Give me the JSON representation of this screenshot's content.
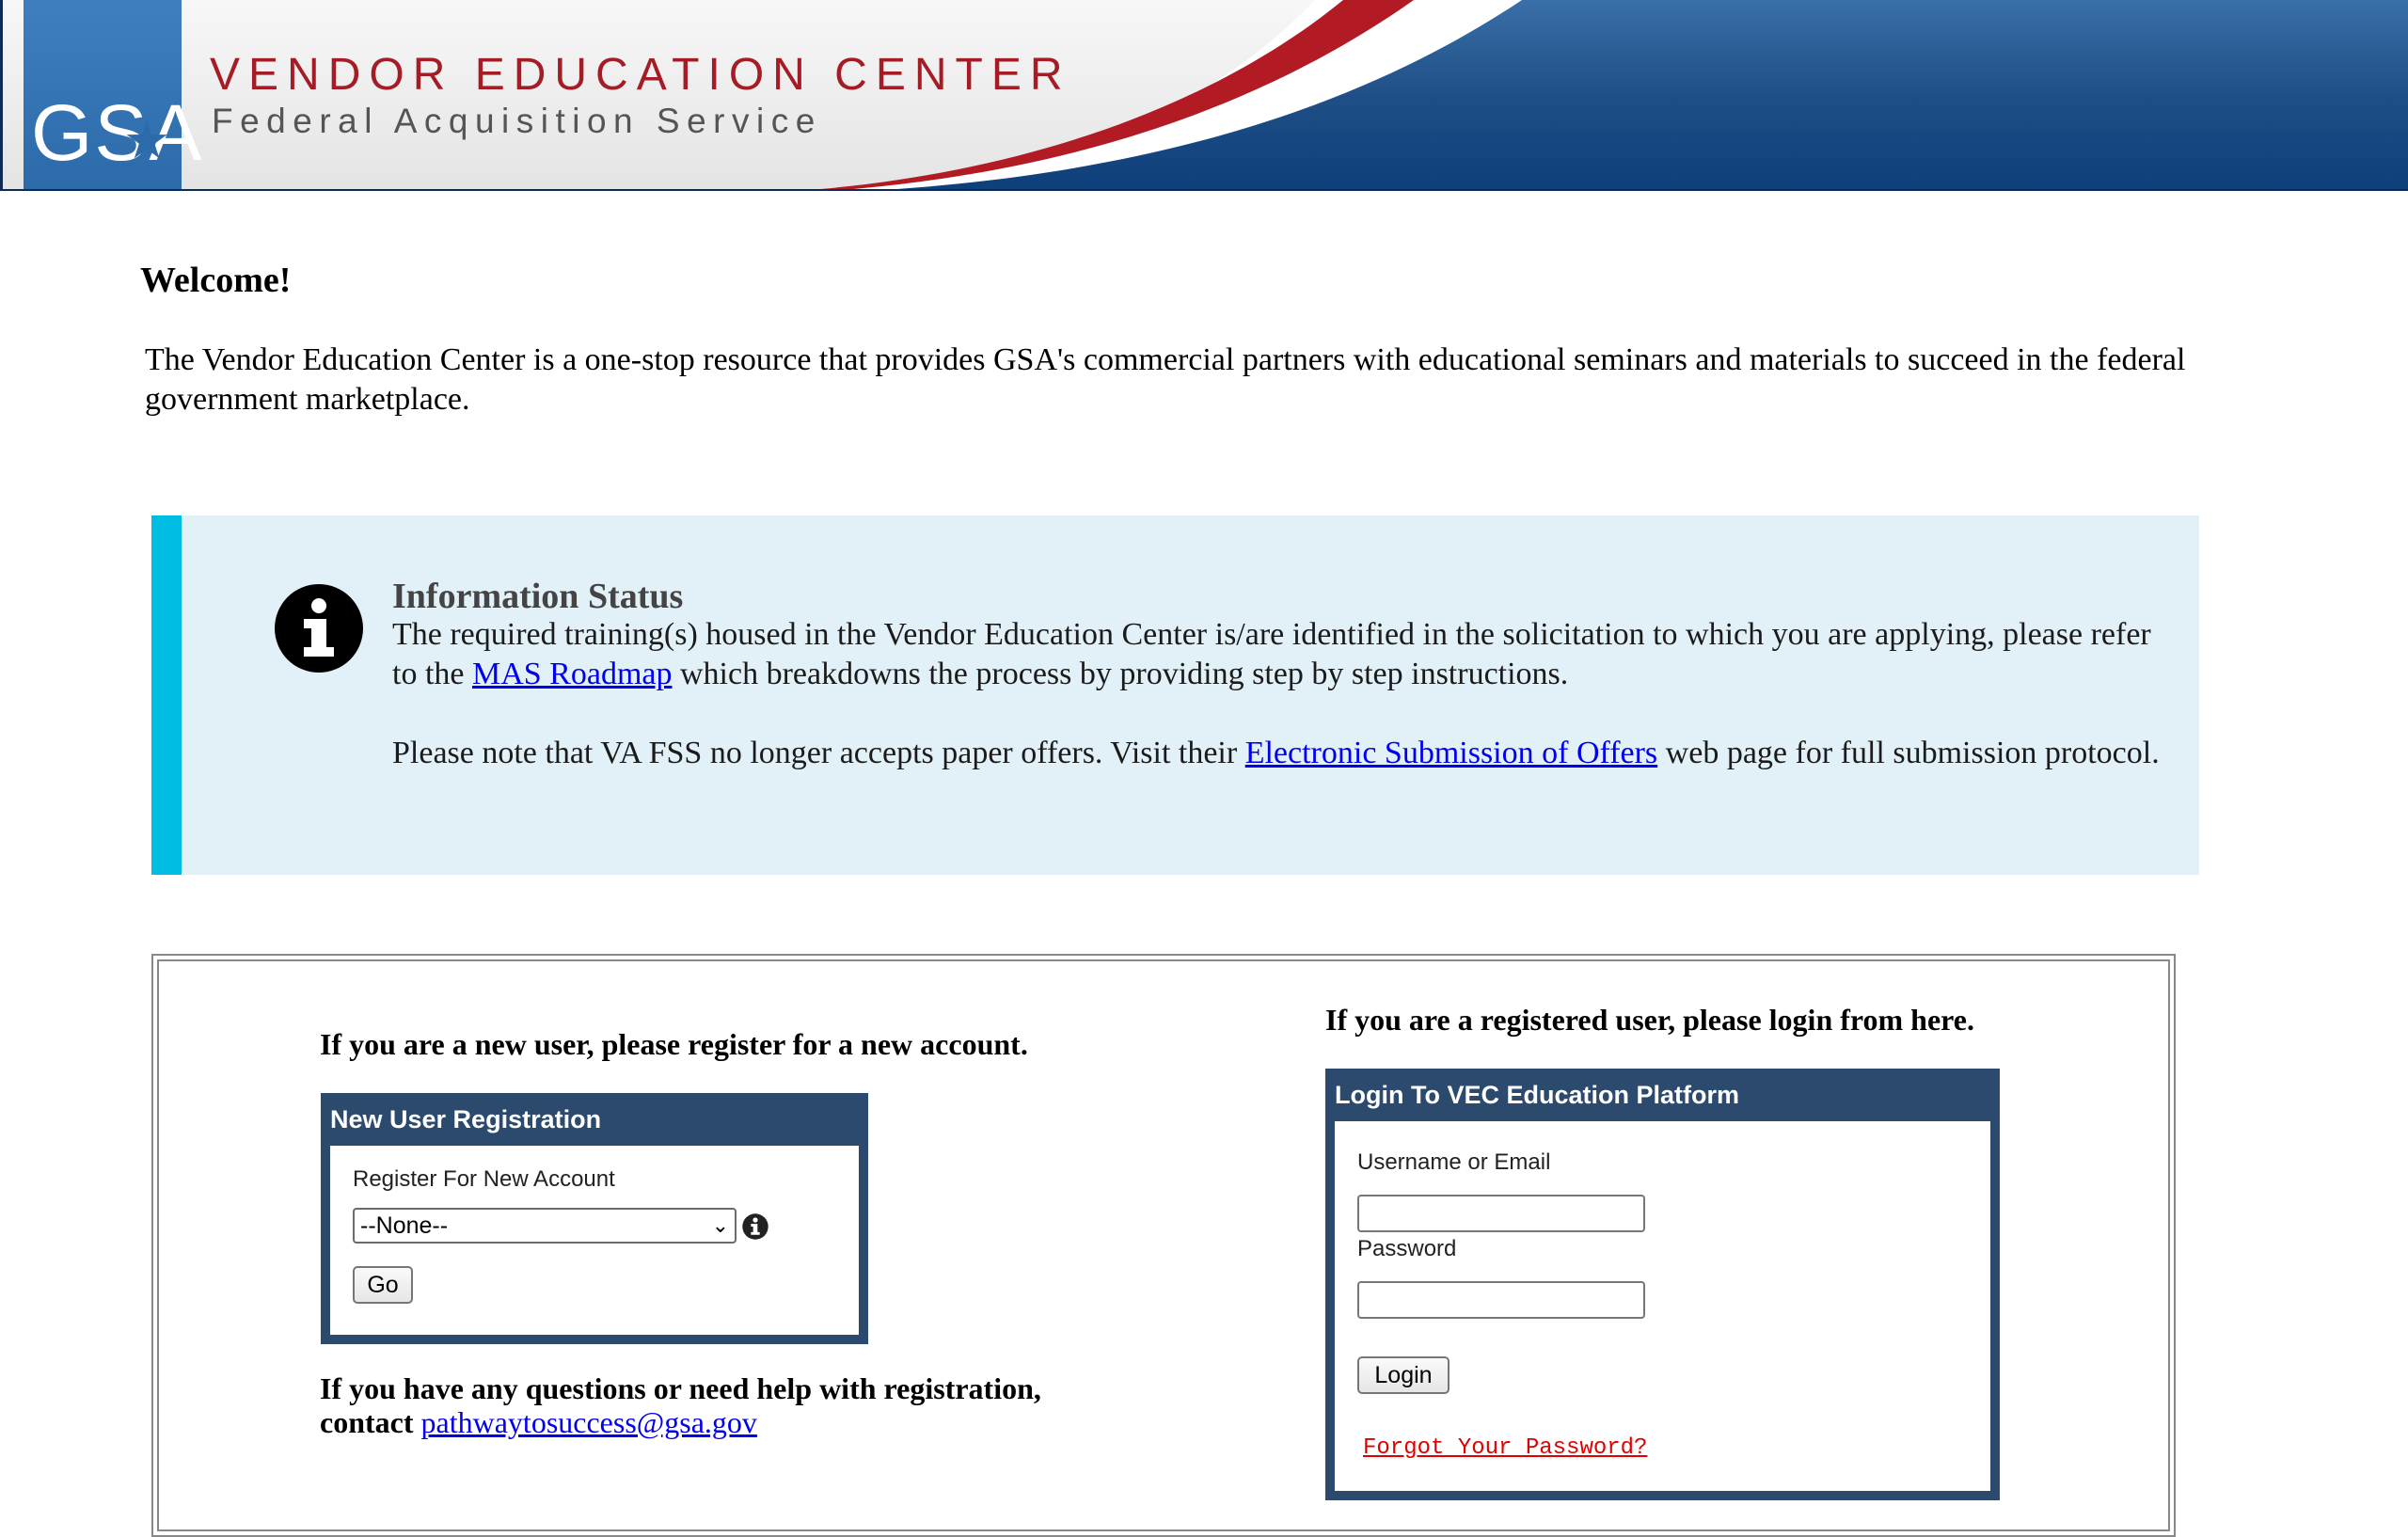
{
  "banner": {
    "logo_text": "GSA",
    "title": "VENDOR EDUCATION CENTER",
    "subtitle": "Federal Acquisition Service",
    "colors": {
      "logo_blue": "#2c6aa9",
      "title_red": "#a41d26",
      "swoosh_red": "#b31b24",
      "band_navy": "#1f4f86"
    }
  },
  "welcome": {
    "heading": "Welcome!",
    "intro": "The Vendor Education Center is a one-stop resource that provides GSA's commercial partners with educational seminars and materials to succeed in the federal government marketplace."
  },
  "info_status": {
    "icon": "info-circle-icon",
    "title": "Information Status",
    "para1_before": "The required training(s) housed in the Vendor Education Center is/are identified in the solicitation to which you are applying, please refer to the ",
    "para1_link": "MAS Roadmap",
    "para1_after": " which breakdowns the process by providing step by step instructions.",
    "para2_before": "Please note that VA FSS no longer accepts paper offers. Visit their ",
    "para2_link": "Electronic Submission of Offers",
    "para2_after": " web page for full submission protocol.",
    "colors": {
      "background": "#e1f1f7",
      "accent_bar": "#00bde3"
    }
  },
  "new_user": {
    "heading": "If you are a new user, please register for a new account.",
    "panel_title": "New User Registration",
    "field_label": "Register For New Account",
    "select_value": "--None--",
    "go_label": "Go",
    "help_before": "If you have any questions or need help with registration, contact ",
    "help_email": "pathwaytosuccess@gsa.gov"
  },
  "login": {
    "heading": "If you are a registered user, please login from here.",
    "panel_title": "Login To VEC Education Platform",
    "username_label": "Username or Email",
    "password_label": "Password",
    "login_label": "Login",
    "forgot_label": "Forgot Your Password?",
    "colors": {
      "panel": "#2b4a6e",
      "forgot_link": "#e00000"
    }
  }
}
